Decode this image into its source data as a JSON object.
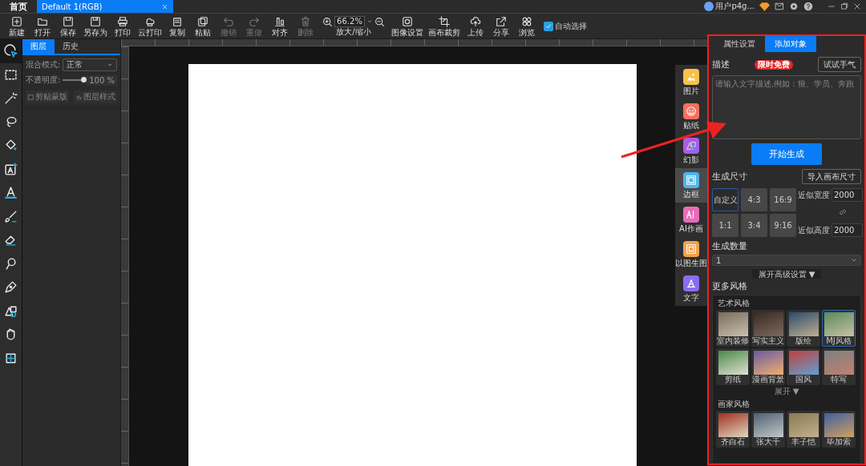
{
  "title_bar": {
    "home": "首页",
    "document_tab": {
      "label": "Default 1(RGB)",
      "selected": true
    },
    "user_name": "用户p4g..."
  },
  "toolbar": {
    "items": [
      {
        "label": "新建",
        "disabled": false
      },
      {
        "label": "打开",
        "disabled": false
      },
      {
        "label": "保存",
        "disabled": false
      },
      {
        "label": "另存为",
        "disabled": false
      },
      {
        "label": "打印",
        "disabled": false
      },
      {
        "label": "云打印",
        "disabled": false
      },
      {
        "label": "复制",
        "disabled": false
      },
      {
        "label": "粘贴",
        "disabled": false
      },
      {
        "label": "撤销",
        "disabled": true
      },
      {
        "label": "重做",
        "disabled": true
      },
      {
        "label": "对齐",
        "disabled": false
      },
      {
        "label": "删除",
        "disabled": true
      }
    ],
    "zoom": {
      "value": "66.2%",
      "label": "放大/缩小"
    },
    "items_after": [
      {
        "label": "图像设置",
        "disabled": false
      },
      {
        "label": "画布裁剪",
        "disabled": false
      },
      {
        "label": "上传",
        "disabled": false
      },
      {
        "label": "分享",
        "disabled": false
      },
      {
        "label": "浏览",
        "disabled": false
      }
    ],
    "auto_select": {
      "label": "自动选择",
      "checked": true
    }
  },
  "tools": [
    {
      "selected": true
    },
    {
      "selected": false
    },
    {
      "selected": false
    },
    {
      "selected": false
    },
    {
      "selected": false
    },
    {
      "selected": false
    },
    {
      "selected": false
    },
    {
      "selected": false
    },
    {
      "selected": false
    },
    {
      "selected": false
    },
    {
      "selected": false
    },
    {
      "selected": false
    },
    {
      "selected": false
    },
    {
      "selected": false
    }
  ],
  "layers_panel": {
    "tabs": [
      {
        "label": "图层",
        "selected": true
      },
      {
        "label": "历史",
        "selected": false
      }
    ],
    "blend_mode": {
      "label": "混合模式:",
      "value": "正常"
    },
    "opacity": {
      "label": "不透明度:",
      "level": 1,
      "value": "100",
      "unit": "%"
    },
    "buttons": [
      {
        "label": "剪贴蒙版",
        "disabled": true
      },
      {
        "label": "图层样式",
        "disabled": true
      }
    ]
  },
  "insert_strip": [
    {
      "label": "图片",
      "color": "#f9c04a",
      "selected": false
    },
    {
      "label": "贴纸",
      "color": "#f4715a",
      "selected": false
    },
    {
      "label": "幻影",
      "color": "#a95ce8",
      "selected": false
    },
    {
      "label": "边框",
      "color": "#4fb4ec",
      "selected": true
    },
    {
      "label": "AI作画",
      "color": "#e96bb9",
      "selected": false
    },
    {
      "label": "以图生图",
      "color": "#f5a04a",
      "selected": false
    },
    {
      "label": "文字",
      "color": "#8b6cf0",
      "selected": false
    }
  ],
  "right_panel": {
    "tabs": [
      {
        "label": "属性设置",
        "selected": false
      },
      {
        "label": "添加对象",
        "selected": true
      }
    ],
    "description": {
      "label": "描述",
      "badge": "限时免费",
      "try_button": "试试手气",
      "placeholder": "请输入文字描述,例如：狼、学员、奔跑"
    },
    "generate_button": "开始生成",
    "size": {
      "label": "生成尺寸",
      "import_button": "导入画布尺寸",
      "ratios": [
        {
          "label": "自定义",
          "selected": true
        },
        {
          "label": "4:3",
          "selected": false
        },
        {
          "label": "16:9",
          "selected": false
        },
        {
          "label": "1:1",
          "selected": false
        },
        {
          "label": "3:4",
          "selected": false
        },
        {
          "label": "9:16",
          "selected": false
        }
      ],
      "width": {
        "label": "近似宽度",
        "value": "2000"
      },
      "height": {
        "label": "近似高度",
        "value": "2000"
      }
    },
    "count": {
      "label": "生成数量",
      "value": "1"
    },
    "advanced_button": "展开高级设置 ▼",
    "more_styles": {
      "label": "更多风格",
      "groups": [
        {
          "title": "艺术风格",
          "styles": [
            {
              "label": "室内装修",
              "selected": false
            },
            {
              "label": "写实主义",
              "selected": false
            },
            {
              "label": "版绘",
              "selected": false
            },
            {
              "label": "MJ风格",
              "selected": true
            },
            {
              "label": "剪纸",
              "selected": false
            },
            {
              "label": "漫画背景",
              "selected": false
            },
            {
              "label": "国风",
              "selected": false
            },
            {
              "label": "特写",
              "selected": false
            }
          ],
          "expand": "展开 ▼"
        },
        {
          "title": "画家风格",
          "styles": [
            {
              "label": "齐白石",
              "selected": false
            },
            {
              "label": "张大千",
              "selected": false
            },
            {
              "label": "丰子恺",
              "selected": false
            },
            {
              "label": "毕加索",
              "selected": false
            }
          ]
        }
      ]
    }
  }
}
